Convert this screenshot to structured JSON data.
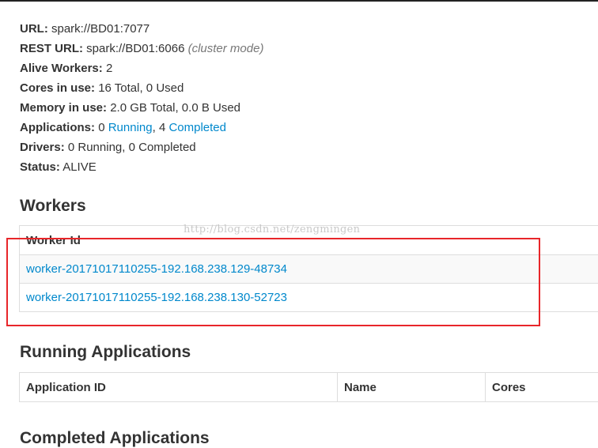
{
  "summary": {
    "url_label": "URL:",
    "url_value": "spark://BD01:7077",
    "rest_url_label": "REST URL:",
    "rest_url_value": "spark://BD01:6066",
    "rest_url_note": "(cluster mode)",
    "alive_workers_label": "Alive Workers:",
    "alive_workers_value": "2",
    "cores_label": "Cores in use:",
    "cores_value": "16 Total, 0 Used",
    "memory_label": "Memory in use:",
    "memory_value": "2.0 GB Total, 0.0 B Used",
    "applications_label": "Applications:",
    "applications_running_count": "0",
    "applications_running_link": "Running",
    "applications_completed_count": "4",
    "applications_completed_link": "Completed",
    "drivers_label": "Drivers:",
    "drivers_value": "0 Running, 0 Completed",
    "status_label": "Status:",
    "status_value": "ALIVE"
  },
  "workers": {
    "heading": "Workers",
    "columns": [
      "Worker Id"
    ],
    "rows": [
      "worker-20171017110255-192.168.238.129-48734",
      "worker-20171017110255-192.168.238.130-52723"
    ]
  },
  "running_applications": {
    "heading": "Running Applications",
    "columns": [
      "Application ID",
      "Name",
      "Cores"
    ]
  },
  "completed_applications": {
    "heading": "Completed Applications"
  },
  "watermark": "http://blog.csdn.net/zengmingen",
  "colors": {
    "link": "#0088cc",
    "highlight": "#e8262a",
    "text": "#333333"
  }
}
